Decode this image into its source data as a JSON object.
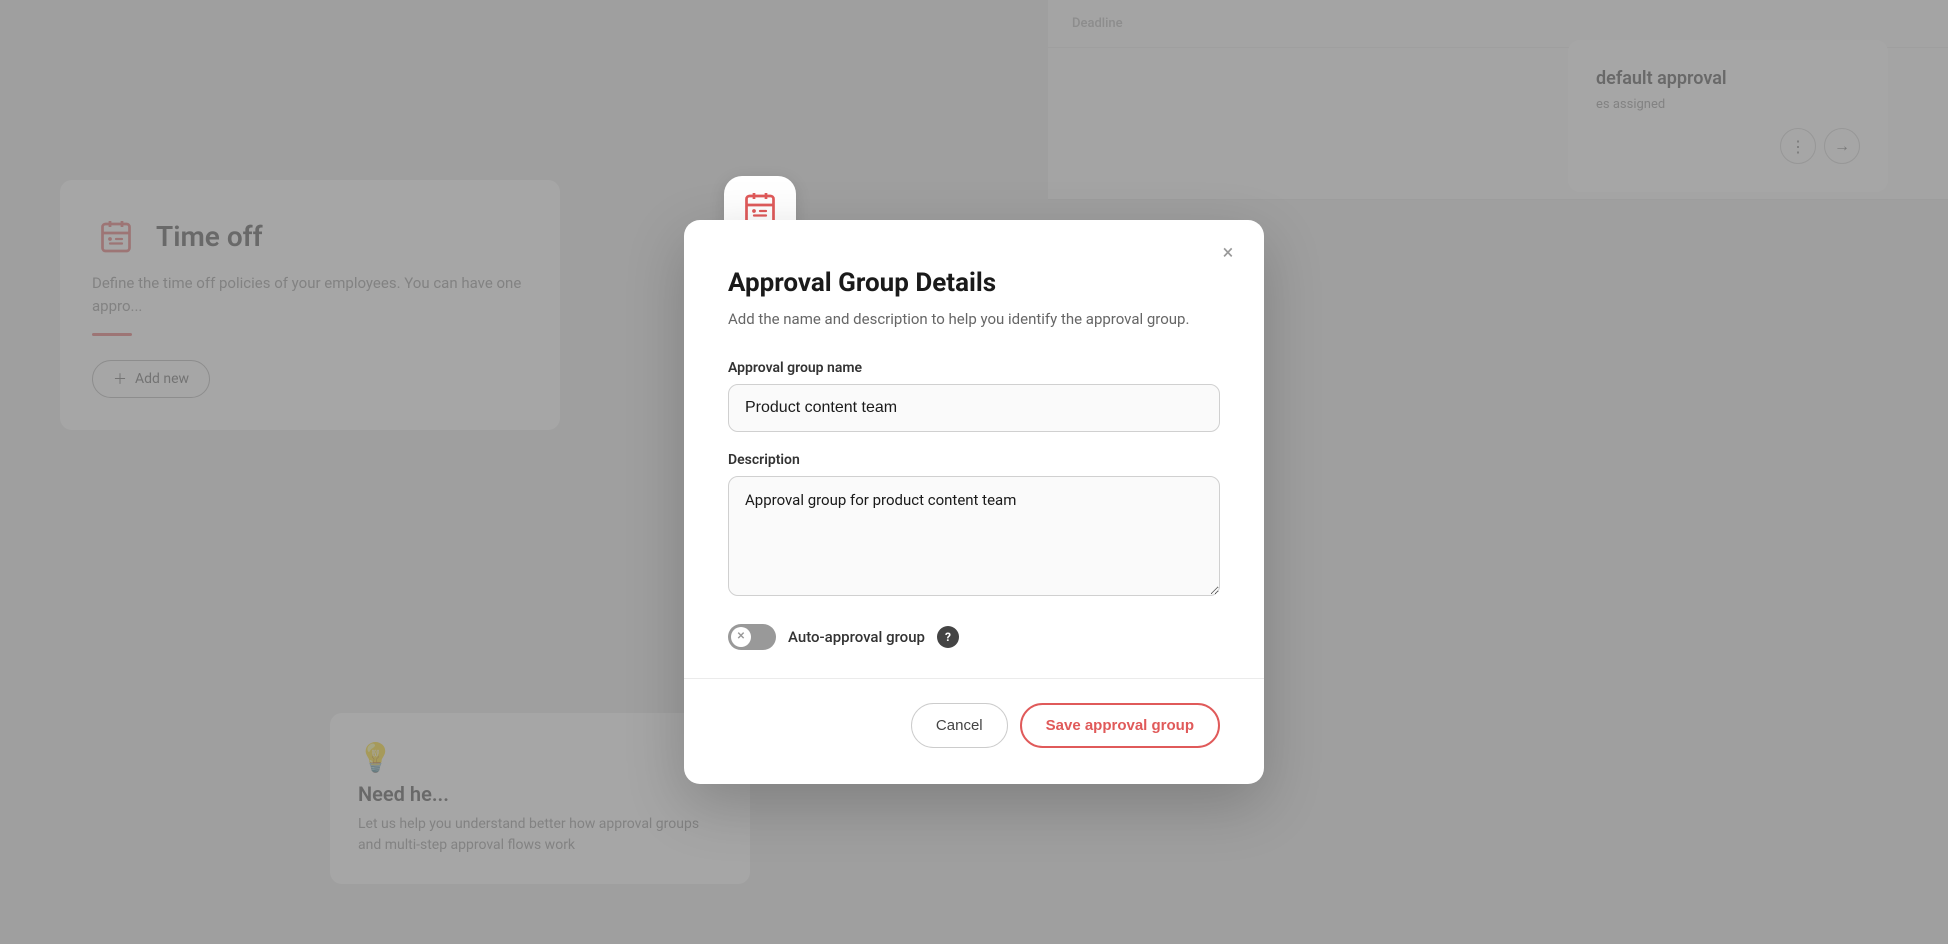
{
  "background": {
    "timeoff_card": {
      "title": "Time off",
      "description": "Define the time off policies of your employees. You can have one appro...",
      "add_button": "Add new",
      "red_line": true
    },
    "right_card": {
      "title": "default approval",
      "subtitle": "es assigned"
    },
    "tip_card": {
      "title": "Need he...",
      "description": "Let us help you understand better how approval groups and multi-step approval flows work"
    },
    "table": {
      "header_col": "Deadline"
    }
  },
  "modal": {
    "icon": "📋",
    "title": "Approval Group Details",
    "subtitle": "Add the name and description to help you identify the approval group.",
    "close_label": "×",
    "form": {
      "name_label": "Approval group name",
      "name_placeholder": "",
      "name_value": "Product content team",
      "description_label": "Description",
      "description_placeholder": "",
      "description_value": "Approval group for product content team",
      "toggle_label": "Auto-approval group",
      "toggle_help": "?",
      "toggle_active": false
    },
    "footer": {
      "cancel_label": "Cancel",
      "save_label": "Save approval group"
    }
  }
}
